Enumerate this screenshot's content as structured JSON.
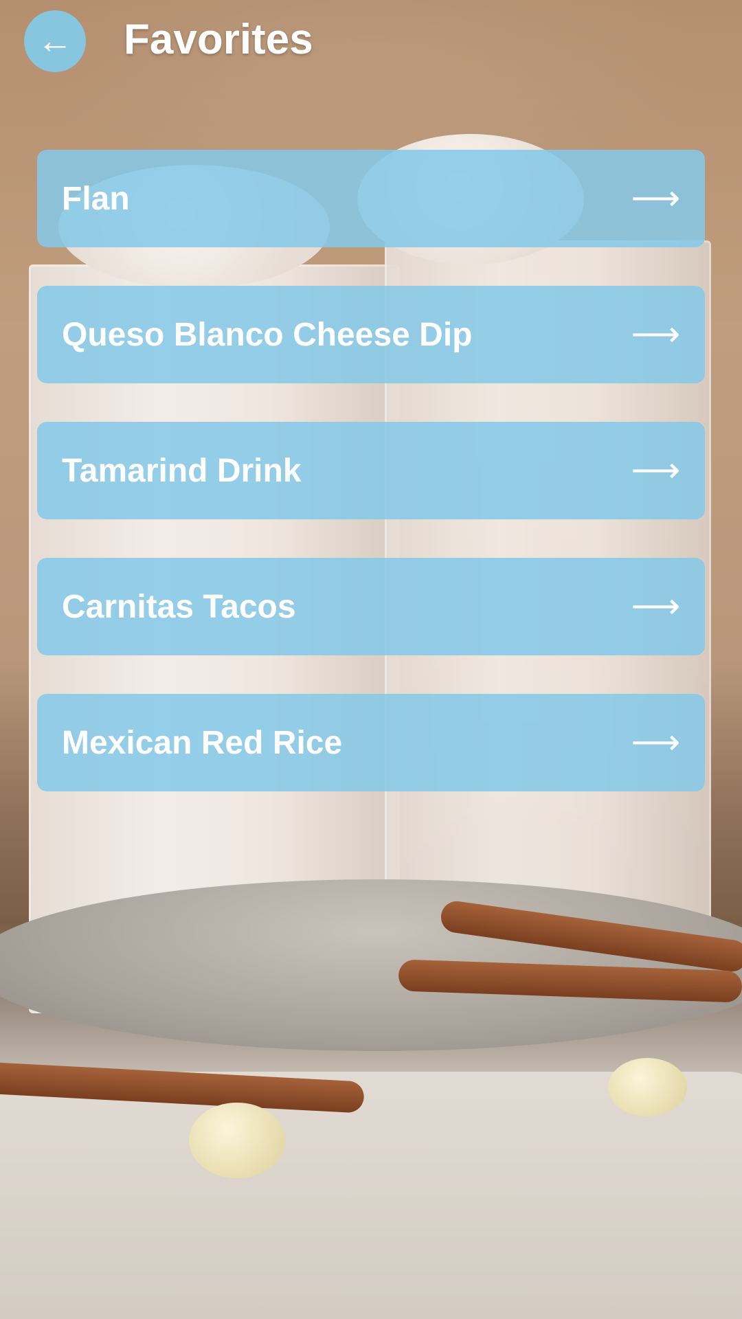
{
  "header": {
    "back_icon": "←",
    "title": "Favorites"
  },
  "favorites": {
    "arrow_icon": "⟶",
    "items": [
      {
        "label": "Flan"
      },
      {
        "label": "Queso Blanco Cheese Dip"
      },
      {
        "label": "Tamarind Drink"
      },
      {
        "label": "Carnitas Tacos"
      },
      {
        "label": "Mexican Red Rice"
      }
    ]
  },
  "theme": {
    "accent": "#86c6de",
    "card": "#85c8e8",
    "text": "#ffffff"
  }
}
